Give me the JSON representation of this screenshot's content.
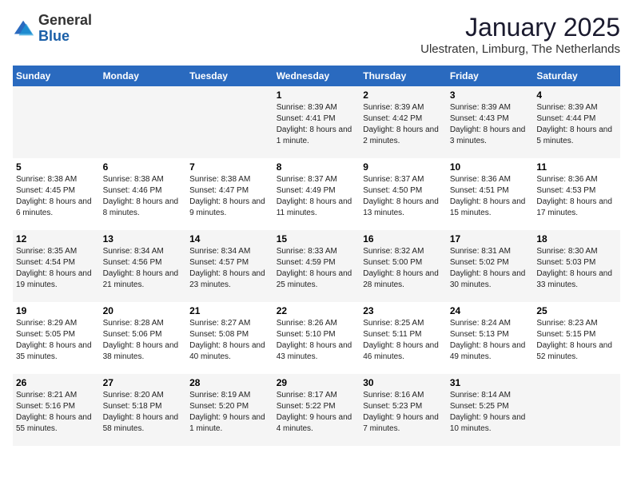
{
  "header": {
    "logo": {
      "general": "General",
      "blue": "Blue"
    },
    "title": "January 2025",
    "location": "Ulestraten, Limburg, The Netherlands"
  },
  "days_of_week": [
    "Sunday",
    "Monday",
    "Tuesday",
    "Wednesday",
    "Thursday",
    "Friday",
    "Saturday"
  ],
  "weeks": [
    [
      {
        "day": "",
        "info": ""
      },
      {
        "day": "",
        "info": ""
      },
      {
        "day": "",
        "info": ""
      },
      {
        "day": "1",
        "info": "Sunrise: 8:39 AM\nSunset: 4:41 PM\nDaylight: 8 hours and 1 minute."
      },
      {
        "day": "2",
        "info": "Sunrise: 8:39 AM\nSunset: 4:42 PM\nDaylight: 8 hours and 2 minutes."
      },
      {
        "day": "3",
        "info": "Sunrise: 8:39 AM\nSunset: 4:43 PM\nDaylight: 8 hours and 3 minutes."
      },
      {
        "day": "4",
        "info": "Sunrise: 8:39 AM\nSunset: 4:44 PM\nDaylight: 8 hours and 5 minutes."
      }
    ],
    [
      {
        "day": "5",
        "info": "Sunrise: 8:38 AM\nSunset: 4:45 PM\nDaylight: 8 hours and 6 minutes."
      },
      {
        "day": "6",
        "info": "Sunrise: 8:38 AM\nSunset: 4:46 PM\nDaylight: 8 hours and 8 minutes."
      },
      {
        "day": "7",
        "info": "Sunrise: 8:38 AM\nSunset: 4:47 PM\nDaylight: 8 hours and 9 minutes."
      },
      {
        "day": "8",
        "info": "Sunrise: 8:37 AM\nSunset: 4:49 PM\nDaylight: 8 hours and 11 minutes."
      },
      {
        "day": "9",
        "info": "Sunrise: 8:37 AM\nSunset: 4:50 PM\nDaylight: 8 hours and 13 minutes."
      },
      {
        "day": "10",
        "info": "Sunrise: 8:36 AM\nSunset: 4:51 PM\nDaylight: 8 hours and 15 minutes."
      },
      {
        "day": "11",
        "info": "Sunrise: 8:36 AM\nSunset: 4:53 PM\nDaylight: 8 hours and 17 minutes."
      }
    ],
    [
      {
        "day": "12",
        "info": "Sunrise: 8:35 AM\nSunset: 4:54 PM\nDaylight: 8 hours and 19 minutes."
      },
      {
        "day": "13",
        "info": "Sunrise: 8:34 AM\nSunset: 4:56 PM\nDaylight: 8 hours and 21 minutes."
      },
      {
        "day": "14",
        "info": "Sunrise: 8:34 AM\nSunset: 4:57 PM\nDaylight: 8 hours and 23 minutes."
      },
      {
        "day": "15",
        "info": "Sunrise: 8:33 AM\nSunset: 4:59 PM\nDaylight: 8 hours and 25 minutes."
      },
      {
        "day": "16",
        "info": "Sunrise: 8:32 AM\nSunset: 5:00 PM\nDaylight: 8 hours and 28 minutes."
      },
      {
        "day": "17",
        "info": "Sunrise: 8:31 AM\nSunset: 5:02 PM\nDaylight: 8 hours and 30 minutes."
      },
      {
        "day": "18",
        "info": "Sunrise: 8:30 AM\nSunset: 5:03 PM\nDaylight: 8 hours and 33 minutes."
      }
    ],
    [
      {
        "day": "19",
        "info": "Sunrise: 8:29 AM\nSunset: 5:05 PM\nDaylight: 8 hours and 35 minutes."
      },
      {
        "day": "20",
        "info": "Sunrise: 8:28 AM\nSunset: 5:06 PM\nDaylight: 8 hours and 38 minutes."
      },
      {
        "day": "21",
        "info": "Sunrise: 8:27 AM\nSunset: 5:08 PM\nDaylight: 8 hours and 40 minutes."
      },
      {
        "day": "22",
        "info": "Sunrise: 8:26 AM\nSunset: 5:10 PM\nDaylight: 8 hours and 43 minutes."
      },
      {
        "day": "23",
        "info": "Sunrise: 8:25 AM\nSunset: 5:11 PM\nDaylight: 8 hours and 46 minutes."
      },
      {
        "day": "24",
        "info": "Sunrise: 8:24 AM\nSunset: 5:13 PM\nDaylight: 8 hours and 49 minutes."
      },
      {
        "day": "25",
        "info": "Sunrise: 8:23 AM\nSunset: 5:15 PM\nDaylight: 8 hours and 52 minutes."
      }
    ],
    [
      {
        "day": "26",
        "info": "Sunrise: 8:21 AM\nSunset: 5:16 PM\nDaylight: 8 hours and 55 minutes."
      },
      {
        "day": "27",
        "info": "Sunrise: 8:20 AM\nSunset: 5:18 PM\nDaylight: 8 hours and 58 minutes."
      },
      {
        "day": "28",
        "info": "Sunrise: 8:19 AM\nSunset: 5:20 PM\nDaylight: 9 hours and 1 minute."
      },
      {
        "day": "29",
        "info": "Sunrise: 8:17 AM\nSunset: 5:22 PM\nDaylight: 9 hours and 4 minutes."
      },
      {
        "day": "30",
        "info": "Sunrise: 8:16 AM\nSunset: 5:23 PM\nDaylight: 9 hours and 7 minutes."
      },
      {
        "day": "31",
        "info": "Sunrise: 8:14 AM\nSunset: 5:25 PM\nDaylight: 9 hours and 10 minutes."
      },
      {
        "day": "",
        "info": ""
      }
    ]
  ]
}
